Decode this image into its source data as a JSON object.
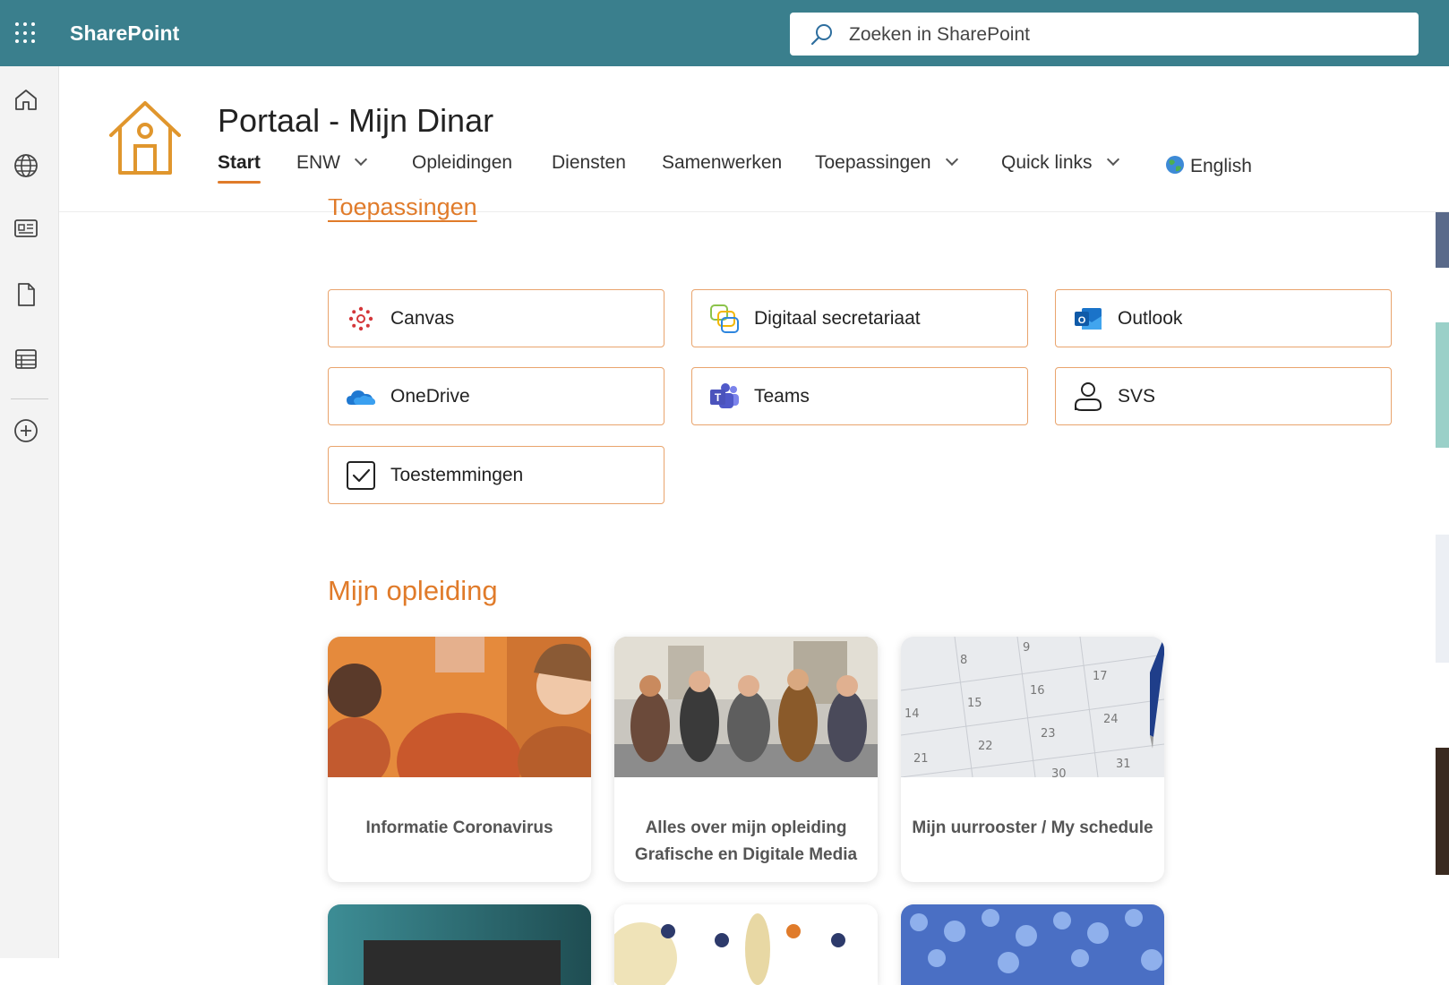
{
  "topbar": {
    "brand": "SharePoint",
    "search_placeholder": "Zoeken in SharePoint",
    "bg_color": "#3a7f8d"
  },
  "rail": {
    "icons": [
      "home-icon",
      "globe-icon",
      "news-icon",
      "document-icon",
      "list-icon",
      "add-icon"
    ]
  },
  "site": {
    "title": "Portaal - Mijn Dinar",
    "accent": "#e07b2a"
  },
  "nav": {
    "items": [
      {
        "label": "Start",
        "active": true
      },
      {
        "label": "ENW",
        "dropdown": true
      },
      {
        "label": "Opleidingen"
      },
      {
        "label": "Diensten"
      },
      {
        "label": "Samenwerken"
      },
      {
        "label": "Toepassingen",
        "dropdown": true
      },
      {
        "label": "Quick links",
        "dropdown": true
      },
      {
        "label": "English",
        "icon": "globe-emoji-icon"
      }
    ]
  },
  "apps": {
    "heading": "Toepassingen",
    "items": [
      {
        "label": "Canvas",
        "icon": "canvas-icon"
      },
      {
        "label": "Digitaal secretariaat",
        "icon": "digital-secretariat-icon"
      },
      {
        "label": "Outlook",
        "icon": "outlook-icon"
      },
      {
        "label": "OneDrive",
        "icon": "onedrive-icon"
      },
      {
        "label": "Teams",
        "icon": "teams-icon"
      },
      {
        "label": "SVS",
        "icon": "person-icon"
      },
      {
        "label": "Toestemmingen",
        "icon": "checkbox-icon"
      }
    ]
  },
  "mijn_opleiding": {
    "heading": "Mijn opleiding",
    "cards": [
      {
        "title": "Informatie Coronavirus"
      },
      {
        "title_line1": "Alles over mijn opleiding",
        "title_line2": "Grafische en Digitale Media"
      },
      {
        "title": "Mijn uurrooster / My schedule"
      }
    ]
  }
}
